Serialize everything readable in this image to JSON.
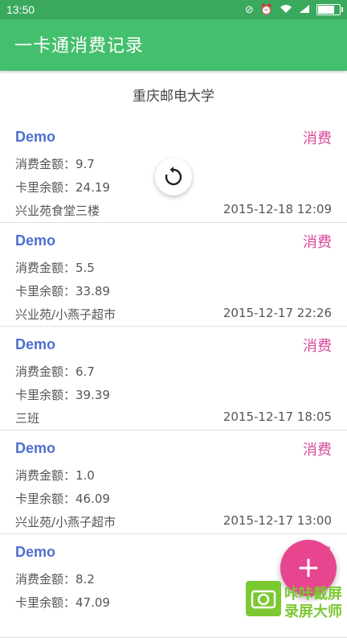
{
  "status_bar": {
    "time": "13:50",
    "icons": [
      "no-sim-icon",
      "alarm-icon",
      "wifi-icon",
      "signal-icon",
      "battery-icon"
    ],
    "battery_fraction": 0.85
  },
  "app_bar": {
    "title": "一卡通消费记录"
  },
  "section_header": "重庆邮电大学",
  "records": [
    {
      "user": "Demo",
      "type": "消费",
      "amount": "消费金额：9.7",
      "balance": "卡里余额：24.19",
      "location": "兴业苑食堂三楼",
      "time": "2015-12-18 12:09"
    },
    {
      "user": "Demo",
      "type": "消费",
      "amount": "消费金额：5.5",
      "balance": "卡里余额：33.89",
      "location": "兴业苑/小燕子超市",
      "time": "2015-12-17 22:26"
    },
    {
      "user": "Demo",
      "type": "消费",
      "amount": "消费金额：6.7",
      "balance": "卡里余额：39.39",
      "location": "三班",
      "time": "2015-12-17 18:05"
    },
    {
      "user": "Demo",
      "type": "消费",
      "amount": "消费金额：1.0",
      "balance": "卡里余额：46.09",
      "location": "兴业苑/小燕子超市",
      "time": "2015-12-17 13:00"
    },
    {
      "user": "Demo",
      "type": "消费",
      "amount": "消费金额：8.2",
      "balance": "卡里余额：47.09",
      "location": "",
      "time": ""
    }
  ],
  "fab": {
    "label": "+"
  },
  "watermark": {
    "line1": "咔咔截屏",
    "line2": "录屏大师"
  },
  "colors": {
    "status_bar": "#3aa95e",
    "app_bar": "#44bf6d",
    "user_name": "#4f6ed1",
    "record_type": "#d6479a",
    "fab": "#e8458f",
    "watermark": "#7cc832"
  }
}
